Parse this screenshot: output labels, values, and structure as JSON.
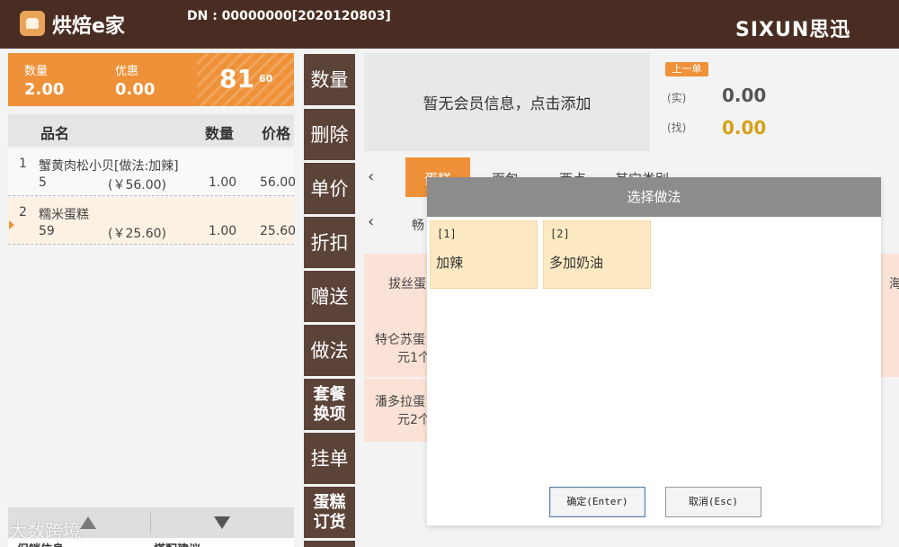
{
  "header": {
    "brand": "烘焙e家",
    "dn": "DN : 00000000[2020120803]",
    "vendor": "SIXUN思迅"
  },
  "summary": {
    "qty_label": "数量",
    "qty_value": "2.00",
    "discount_label": "优惠",
    "discount_value": "0.00",
    "total_int": "81",
    "total_dec": "60"
  },
  "order": {
    "col_name": "品名",
    "col_qty": "数量",
    "col_price": "价格",
    "rows": [
      {
        "index": "1",
        "name": "蟹黄肉松小贝[做法:加辣]",
        "code": "5",
        "unit": "(￥56.00)",
        "qty": "1.00",
        "price": "56.00"
      },
      {
        "index": "2",
        "name": "糯米蛋糕",
        "code": "59",
        "unit": "(￥25.60)",
        "qty": "1.00",
        "price": "25.60"
      }
    ],
    "footer_left": "促销信息",
    "footer_right": "搭配建议"
  },
  "functions": [
    "数量",
    "删除",
    "单价",
    "折扣",
    "赠送",
    "做法",
    "套餐换项",
    "挂单",
    "蛋糕订货"
  ],
  "functions_two_line": [
    [
      "套餐",
      "换项"
    ],
    [
      "蛋糕",
      "订货"
    ]
  ],
  "member": {
    "placeholder": "暂无会员信息，点击添加"
  },
  "payment": {
    "prev_order": "上一单",
    "paid_label": "(实)",
    "paid_value": "0.00",
    "change_label": "(找)",
    "change_value": "0.00",
    "change_color": "#d4a017"
  },
  "categories": {
    "prev_icon": "chevron-left-icon",
    "tabs": [
      "蛋糕",
      "面包",
      "西点",
      "其它类别"
    ],
    "sub_prefix": "畅",
    "products_left": [
      "拔丝蛋",
      "特仑苏蛋",
      "元1个",
      "潘多拉蛋",
      "元2个"
    ],
    "products_right_first": "海"
  },
  "dialog": {
    "title": "选择做法",
    "methods": [
      {
        "no": "[1]",
        "name": "加辣"
      },
      {
        "no": "[2]",
        "name": "多加奶油"
      }
    ],
    "confirm": "确定(Enter)",
    "cancel": "取消(Esc)"
  },
  "watermark": "大数跨境",
  "colors": {
    "header_bg": "#4a2d22",
    "accent": "#ee9138",
    "func_btn": "#5b4338",
    "method_bg": "#fdeac3"
  }
}
